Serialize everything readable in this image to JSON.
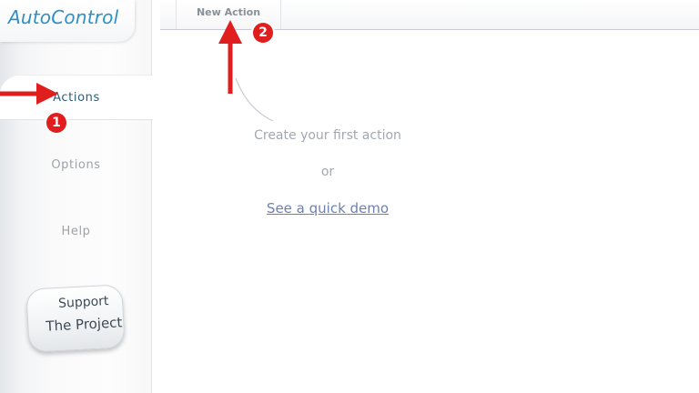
{
  "app": {
    "title": "AutoControl"
  },
  "sidebar": {
    "items": [
      {
        "label": "Actions",
        "active": true
      },
      {
        "label": "Options",
        "active": false
      },
      {
        "label": "Help",
        "active": false
      }
    ],
    "support": {
      "line1": "Support",
      "line2": "The Project"
    }
  },
  "tabs": [
    {
      "label": "New Action"
    }
  ],
  "empty_state": {
    "title": "Create your first action",
    "or_text": "or",
    "demo_link": "See a quick demo"
  },
  "annotations": {
    "badge_1": "1",
    "badge_2": "2",
    "color": "#e01e1e"
  },
  "icons": {
    "arrow_right": "arrow-right-icon",
    "arrow_up": "arrow-up-icon"
  }
}
